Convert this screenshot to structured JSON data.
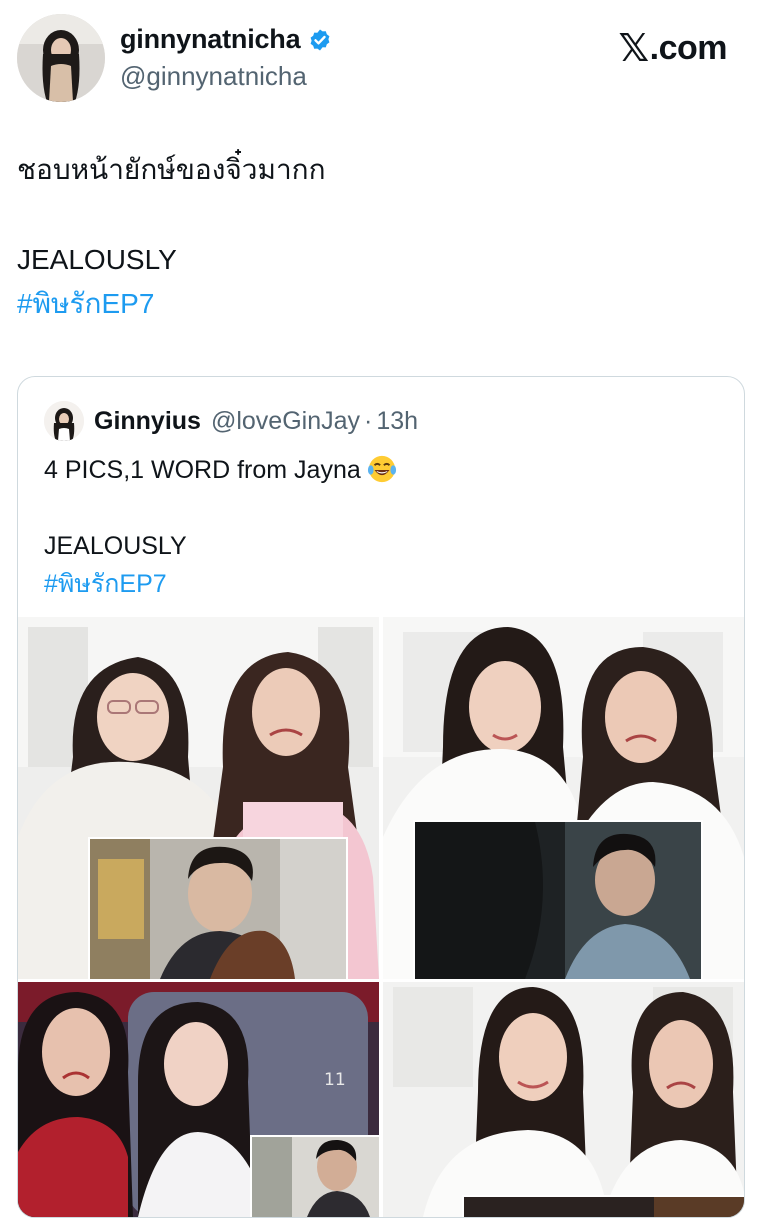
{
  "author": {
    "display_name": "ginnynatnicha",
    "handle": "@ginnynatnicha",
    "verified_icon": "verified-badge-icon",
    "avatar_icon": "profile-avatar"
  },
  "brand": {
    "mark": "𝕏",
    "text": ".com"
  },
  "tweet": {
    "line1": "ชอบหน้ายักษ์ของจิ๋วมากก",
    "line2": "JEALOUSLY",
    "hashtag": "#พิษรักEP7"
  },
  "quoted": {
    "display_name": "Ginnyius",
    "handle": "@loveGinJay",
    "separator": "·",
    "time": "13h",
    "line1": "4 PICS,1 WORD from Jayna",
    "emoji": "face-with-tears-of-joy",
    "line2": "JEALOUSLY",
    "hashtag": "#พิษรักEP7",
    "media_caption_number": "11"
  },
  "colors": {
    "link": "#1d9bf0",
    "verified": "#1d9bf0",
    "muted": "#536471",
    "border": "#cfd9de"
  }
}
